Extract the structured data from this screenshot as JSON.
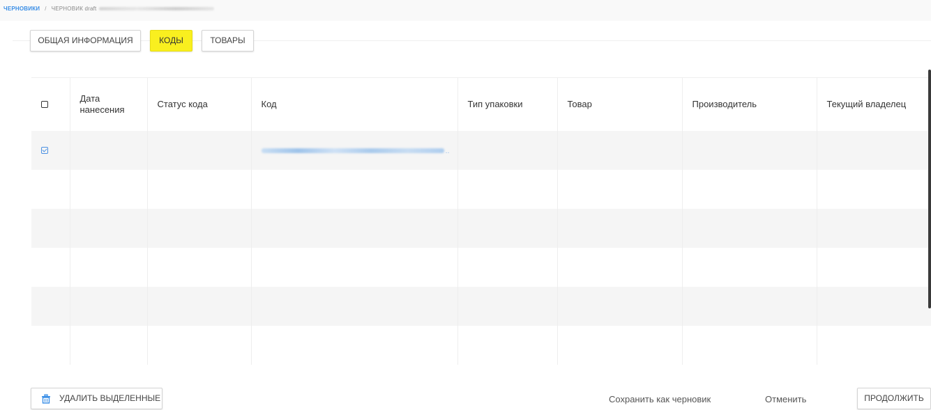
{
  "breadcrumb": {
    "root": "ЧЕРНОВИКИ",
    "separator": "/",
    "current": "ЧЕРНОВИК draft"
  },
  "tabs": [
    {
      "label": "ОБЩАЯ ИНФОРМАЦИЯ",
      "active": false
    },
    {
      "label": "КОДЫ",
      "active": true
    },
    {
      "label": "ТОВАРЫ",
      "active": false
    }
  ],
  "table": {
    "columns": [
      "Дата нанесения",
      "Статус кода",
      "Код",
      "Тип упаковки",
      "Товар",
      "Производитель",
      "Текущий владелец"
    ],
    "rows": [
      {
        "checked": true,
        "date": "",
        "status": "",
        "code_suffix": "..",
        "pack": "",
        "product": "",
        "maker": "",
        "owner": ""
      }
    ]
  },
  "footer": {
    "delete_label": "УДАЛИТЬ ВЫДЕЛЕННЫЕ",
    "save_draft_label": "Сохранить как черновик",
    "cancel_label": "Отменить",
    "continue_label": "ПРОДОЛЖИТЬ"
  },
  "colors": {
    "active_tab": "#f9ef1f",
    "link": "#3a8ee6",
    "checkbox_checked": "#4a90e2",
    "row_stripe": "#f5f5f5"
  },
  "icons": {
    "delete": "trash-icon",
    "checkbox": "checkbox-icon"
  }
}
